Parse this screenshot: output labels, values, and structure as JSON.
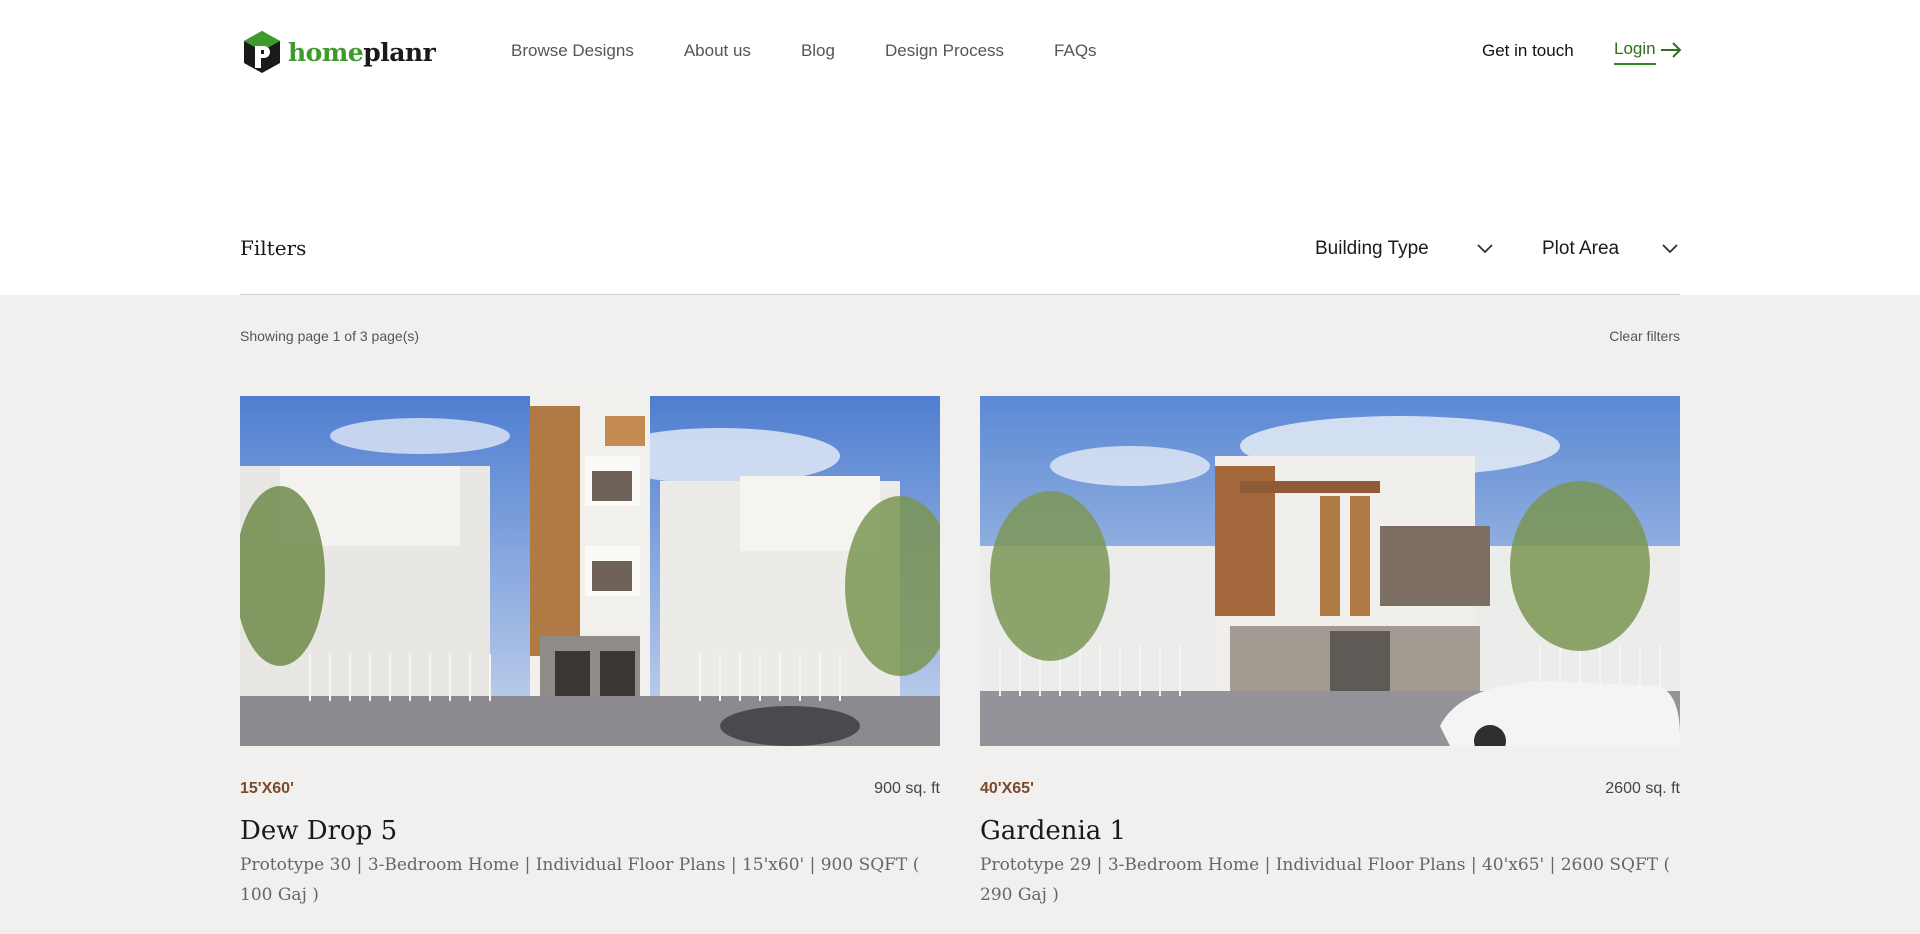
{
  "brand": {
    "name_part1": "home",
    "name_part2": "planr",
    "accent": "#3f9a2c"
  },
  "nav": [
    {
      "label": "Browse Designs"
    },
    {
      "label": "About us"
    },
    {
      "label": "Blog"
    },
    {
      "label": "Design Process"
    },
    {
      "label": "FAQs"
    }
  ],
  "header": {
    "contact_label": "Get in touch",
    "login_label": "Login",
    "login_icon": "arrow-right-icon"
  },
  "filters": {
    "title": "Filters",
    "building_type": "Building Type",
    "plot_area": "Plot Area",
    "dropdown_icon": "chevron-down-icon"
  },
  "results": {
    "showing": "Showing page 1 of 3 page(s)",
    "clear": "Clear filters"
  },
  "cards": [
    {
      "dims": "15'X60'",
      "area": "900 sq. ft",
      "title": "Dew Drop 5",
      "desc": "Prototype 30 | 3-Bedroom Home | Individual Floor Plans | 15'x60' | 900 SQFT ( 100 Gaj )"
    },
    {
      "dims": "40'X65'",
      "area": "2600 sq. ft",
      "title": "Gardenia 1",
      "desc": "Prototype 29 | 3-Bedroom Home | Individual Floor Plans | 40'x65' | 2600 SQFT ( 290 Gaj )"
    }
  ],
  "colors": {
    "dims": "#7a4a2c",
    "listing_bg": "#f1f0ee",
    "login": "#2f6f1f"
  }
}
